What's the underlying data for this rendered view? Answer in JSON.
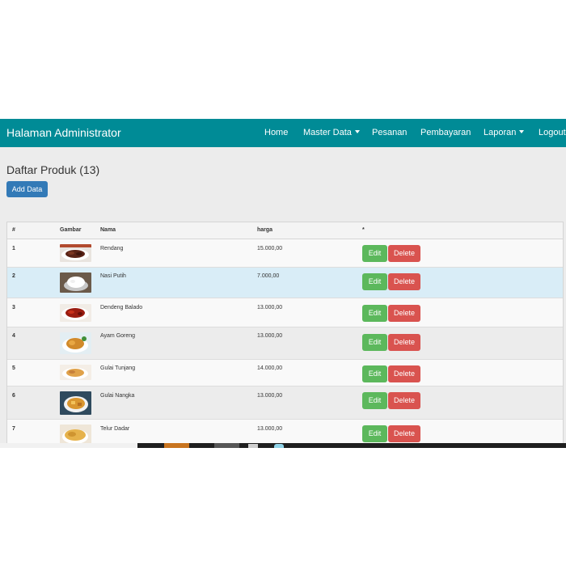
{
  "header": {
    "brand": "Halaman Administrator",
    "nav": [
      {
        "label": "Home",
        "dropdown": false
      },
      {
        "label": "Master Data",
        "dropdown": true
      },
      {
        "label": "Pesanan",
        "dropdown": false
      },
      {
        "label": "Pembayaran",
        "dropdown": false
      },
      {
        "label": "Laporan",
        "dropdown": true
      },
      {
        "label": "Logout",
        "dropdown": false
      }
    ]
  },
  "page": {
    "title": "Daftar Produk (13)",
    "add_button": "Add Data"
  },
  "table": {
    "headers": [
      "#",
      "Gambar",
      "Nama",
      "harga",
      "*"
    ],
    "rows": [
      {
        "no": "1",
        "nama": "Rendang",
        "harga": "15.000,00",
        "image": "rendang-photo"
      },
      {
        "no": "2",
        "nama": "Nasi Putih",
        "harga": "7.000,00",
        "image": "nasi-putih-photo"
      },
      {
        "no": "3",
        "nama": "Dendeng Balado",
        "harga": "13.000,00",
        "image": "dendeng-balado-photo"
      },
      {
        "no": "4",
        "nama": "Ayam Goreng",
        "harga": "13.000,00",
        "image": "ayam-goreng-photo"
      },
      {
        "no": "5",
        "nama": "Gulai Tunjang",
        "harga": "14.000,00",
        "image": "gulai-tunjang-photo"
      },
      {
        "no": "6",
        "nama": "Gulai Nangka",
        "harga": "13.000,00",
        "image": "gulai-nangka-photo"
      },
      {
        "no": "7",
        "nama": "Telur Dadar",
        "harga": "13.000,00",
        "image": "telur-dadar-photo"
      }
    ],
    "edit_label": "Edit",
    "delete_label": "Delete"
  },
  "colors": {
    "navbar": "#008b96",
    "primary_button": "#337ab7",
    "edit_button": "#5cb85c",
    "delete_button": "#d9534f",
    "highlight_row": "#d9edf7"
  }
}
